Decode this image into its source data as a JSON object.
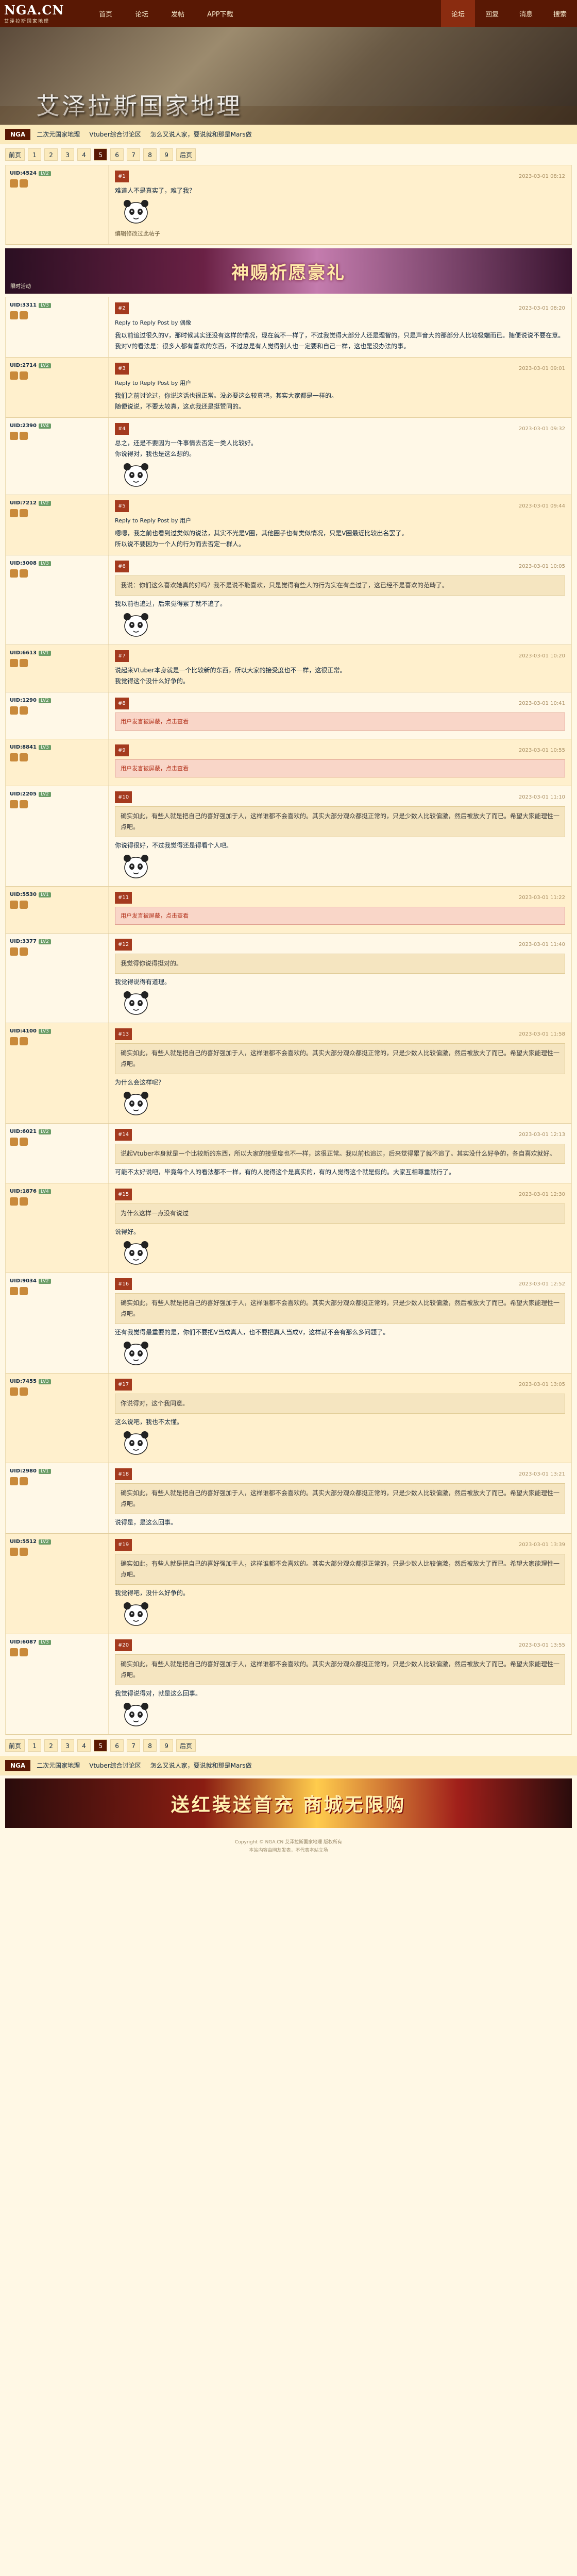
{
  "logo": {
    "title": "NGA.CN",
    "subtitle": "艾泽拉斯国家地理"
  },
  "nav": [
    "首页",
    "论坛",
    "发帖",
    "APP下载"
  ],
  "nav_right": [
    "论坛",
    "回复",
    "消息",
    "搜索"
  ],
  "banner_title": "艾泽拉斯国家地理",
  "crumb": {
    "current": "NGA",
    "items": [
      "二次元国家地理",
      "Vtuber综合讨论区",
      "怎么又说人家，要说就和那是Mars做"
    ]
  },
  "pager": [
    "前页",
    "1",
    "2",
    "3",
    "4",
    "5",
    "6",
    "7",
    "8",
    "9",
    "后页"
  ],
  "pager_active": "5",
  "ad1": {
    "title": "神赐祈愿豪礼",
    "sub": "限时活动"
  },
  "ad2": {
    "title": "送红装送首充 商城无限购"
  },
  "posts": [
    {
      "user": "UID:4524",
      "lv": "LV2",
      "floor": "#1",
      "time": "2023-03-01 08:12",
      "text": "难道人不是真实了，难了我？",
      "sub": "编辑修改过此帖子",
      "img": "panda"
    },
    {
      "user": "UID:3311",
      "lv": "LV3",
      "floor": "#2",
      "time": "2023-03-01 08:20",
      "quote_user": "Reply to Reply Post by 偶像",
      "text": "我以前追过很久的V，那时候其实还没有这样的情况，现在就不一样了，不过我觉得大部分人还是理智的，只是声音大的那部分人比较极端而已。随便说说不要在意。",
      "text2": "我对V的看法是：很多人都有喜欢的东西，不过总是有人觉得别人也一定要和自己一样，这也是没办法的事。"
    },
    {
      "user": "UID:2714",
      "lv": "LV2",
      "floor": "#3",
      "time": "2023-03-01 09:01",
      "quote_user": "Reply to Reply Post by 用户",
      "text": "我们之前讨论过，你说这话也很正常。没必要这么较真吧，其实大家都是一样的。",
      "text2": "随便说说，不要太较真，这点我还是挺赞同的。"
    },
    {
      "user": "UID:2390",
      "lv": "LV4",
      "floor": "#4",
      "time": "2023-03-01 09:32",
      "text": "总之，还是不要因为一件事情去否定一类人比较好。",
      "text2": "你说得对，我也是这么想的。",
      "img": "panda"
    },
    {
      "user": "UID:7212",
      "lv": "LV2",
      "floor": "#5",
      "time": "2023-03-01 09:44",
      "quote_user": "Reply to Reply Post by 用户",
      "text": "嗯嗯，我之前也看到过类似的说法，其实不光是V圈，其他圈子也有类似情况，只是V圈最近比较出名罢了。",
      "text2": "所以说不要因为一个人的行为而去否定一群人。"
    },
    {
      "user": "UID:3008",
      "lv": "LV3",
      "floor": "#6",
      "time": "2023-03-01 10:05",
      "quote_text": "我说：你们这么喜欢她真的好吗？我不是说不能喜欢，只是觉得有些人的行为实在有些过了，这已经不是喜欢的范畴了。",
      "text": "我以前也追过，后来觉得累了就不追了。",
      "img": "panda"
    },
    {
      "user": "UID:6613",
      "lv": "LV1",
      "floor": "#7",
      "time": "2023-03-01 10:20",
      "text": "说起来Vtuber本身就是一个比较新的东西，所以大家的接受度也不一样，这很正常。",
      "text2": "我觉得这个没什么好争的。"
    },
    {
      "user": "UID:1290",
      "lv": "LV2",
      "floor": "#8",
      "time": "2023-03-01 10:41",
      "warn": "用户发言被屏蔽，点击查看"
    },
    {
      "user": "UID:8841",
      "lv": "LV3",
      "floor": "#9",
      "time": "2023-03-01 10:55",
      "warn": "用户发言被屏蔽，点击查看"
    },
    {
      "user": "UID:2205",
      "lv": "LV2",
      "floor": "#10",
      "time": "2023-03-01 11:10",
      "quote_text": "确实如此，有些人就是把自己的喜好强加于人，这样谁都不会喜欢的。其实大部分观众都挺正常的，只是少数人比较偏激，然后被放大了而已。希望大家能理性一点吧。",
      "text": "你说得很好，不过我觉得还是得看个人吧。",
      "img": "panda"
    },
    {
      "user": "UID:5530",
      "lv": "LV1",
      "floor": "#11",
      "time": "2023-03-01 11:22",
      "warn": "用户发言被屏蔽，点击查看"
    },
    {
      "user": "UID:3377",
      "lv": "LV2",
      "floor": "#12",
      "time": "2023-03-01 11:40",
      "quote_text": "我觉得你说得挺对的。",
      "text": "我觉得说得有道理。",
      "img": "panda"
    },
    {
      "user": "UID:4100",
      "lv": "LV3",
      "floor": "#13",
      "time": "2023-03-01 11:58",
      "quote_text": "确实如此，有些人就是把自己的喜好强加于人，这样谁都不会喜欢的。其实大部分观众都挺正常的，只是少数人比较偏激，然后被放大了而已。希望大家能理性一点吧。",
      "text": "为什么会这样呢？",
      "img": "panda"
    },
    {
      "user": "UID:6021",
      "lv": "LV2",
      "floor": "#14",
      "time": "2023-03-01 12:13",
      "quote_text": "说起Vtuber本身就是一个比较新的东西，所以大家的接受度也不一样，这很正常。我以前也追过，后来觉得累了就不追了。其实没什么好争的，各自喜欢就好。",
      "text": "可能不太好说吧，毕竟每个人的看法都不一样，有的人觉得这个是真实的，有的人觉得这个就是假的。大家互相尊重就行了。"
    },
    {
      "user": "UID:1876",
      "lv": "LV4",
      "floor": "#15",
      "time": "2023-03-01 12:30",
      "quote_text": "为什么这样一点没有说过",
      "text": "说得好。",
      "img": "panda"
    },
    {
      "user": "UID:9034",
      "lv": "LV2",
      "floor": "#16",
      "time": "2023-03-01 12:52",
      "quote_text": "确实如此，有些人就是把自己的喜好强加于人，这样谁都不会喜欢的。其实大部分观众都挺正常的，只是少数人比较偏激，然后被放大了而已。希望大家能理性一点吧。",
      "text": "还有我觉得最重要的是，你们不要把V当成真人，也不要把真人当成V，这样就不会有那么多问题了。",
      "img": "panda"
    },
    {
      "user": "UID:7455",
      "lv": "LV3",
      "floor": "#17",
      "time": "2023-03-01 13:05",
      "quote_text": "你说得对，这个我同意。",
      "text": "这么说吧，我也不太懂。",
      "img": "panda"
    },
    {
      "user": "UID:2980",
      "lv": "LV1",
      "floor": "#18",
      "time": "2023-03-01 13:21",
      "quote_text": "确实如此，有些人就是把自己的喜好强加于人，这样谁都不会喜欢的。其实大部分观众都挺正常的，只是少数人比较偏激，然后被放大了而已。希望大家能理性一点吧。",
      "text": "说得是，是这么回事。"
    },
    {
      "user": "UID:5512",
      "lv": "LV2",
      "floor": "#19",
      "time": "2023-03-01 13:39",
      "quote_text": "确实如此，有些人就是把自己的喜好强加于人，这样谁都不会喜欢的。其实大部分观众都挺正常的，只是少数人比较偏激，然后被放大了而已。希望大家能理性一点吧。",
      "text": "我觉得吧，没什么好争的。",
      "img": "panda"
    },
    {
      "user": "UID:6087",
      "lv": "LV3",
      "floor": "#20",
      "time": "2023-03-01 13:55",
      "quote_text": "确实如此，有些人就是把自己的喜好强加于人，这样谁都不会喜欢的。其实大部分观众都挺正常的，只是少数人比较偏激，然后被放大了而已。希望大家能理性一点吧。",
      "text": "我觉得说得对，就是这么回事。",
      "img": "panda"
    }
  ],
  "footer": [
    "Copyright © NGA.CN 艾泽拉斯国家地理 版权所有",
    "本站内容由网友发表，不代表本站立场"
  ]
}
